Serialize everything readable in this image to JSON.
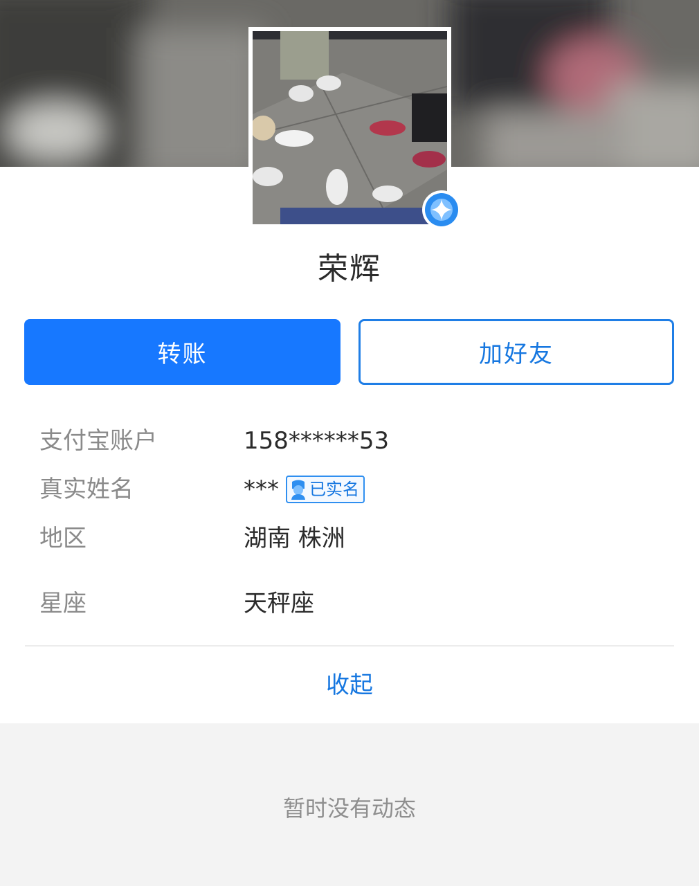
{
  "profile": {
    "nickname": "荣辉",
    "verified_icon": "sparkle-star-icon"
  },
  "actions": {
    "transfer_label": "转账",
    "add_friend_label": "加好友"
  },
  "info": {
    "account": {
      "label": "支付宝账户",
      "value": "158******53"
    },
    "real_name": {
      "label": "真实姓名",
      "value": "***",
      "badge": "已实名"
    },
    "region": {
      "label": "地区",
      "value": "湖南 株洲"
    },
    "zodiac": {
      "label": "星座",
      "value": "天秤座"
    }
  },
  "collapse_label": "收起",
  "feed": {
    "empty_text": "暂时没有动态"
  },
  "colors": {
    "accent": "#1778ff",
    "link": "#1677e0",
    "feed_background": "#f3f3f3"
  }
}
